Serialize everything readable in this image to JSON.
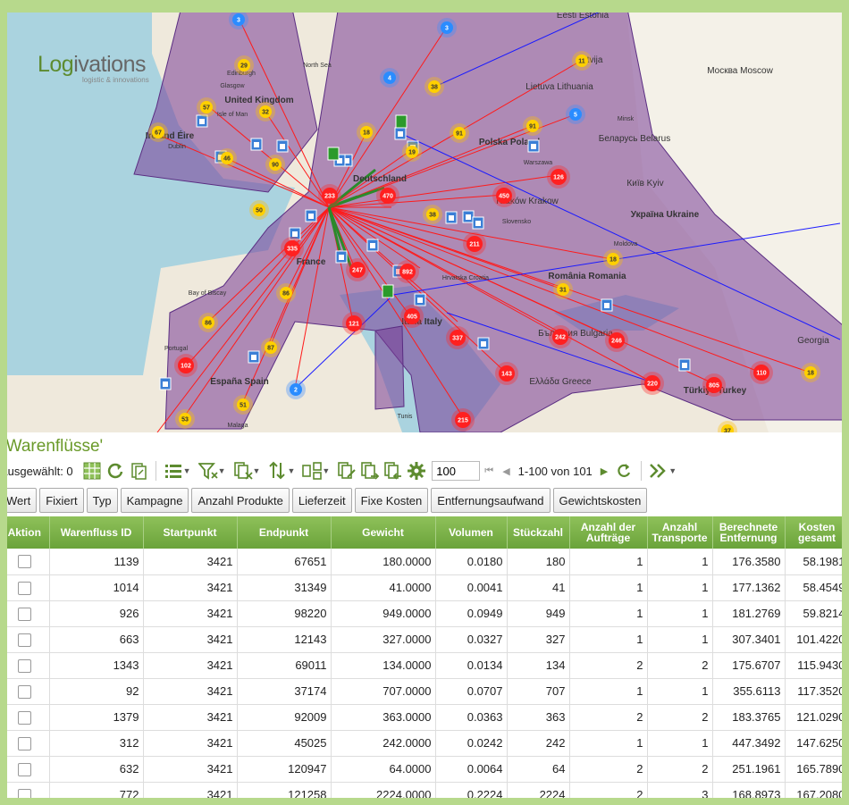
{
  "logo": {
    "main_a": "Log",
    "main_b": "ivations",
    "sub": "logistic & innovations"
  },
  "map_labels": [
    {
      "text": "United Kingdom"
    },
    {
      "text": "Ireland Éire"
    },
    {
      "text": "Deutschland"
    },
    {
      "text": "Polska Poland"
    },
    {
      "text": "France"
    },
    {
      "text": "España Spain"
    },
    {
      "text": "Italia Italy"
    },
    {
      "text": "România Romania"
    },
    {
      "text": "Україна Ukraine"
    },
    {
      "text": "Türkiye Turkey"
    },
    {
      "text": "Беларусь Belarus"
    },
    {
      "text": "Lietuva Lithuania"
    },
    {
      "text": "Eesti Estonia"
    },
    {
      "text": "Latvija"
    },
    {
      "text": "Москва Moscow"
    },
    {
      "text": "Kraków Krakow"
    },
    {
      "text": "Київ Kyiv"
    },
    {
      "text": "Ελλάδα Greece"
    },
    {
      "text": "България Bulgaria"
    },
    {
      "text": "Georgia"
    },
    {
      "text": "Edinburgh"
    },
    {
      "text": "Glasgow"
    },
    {
      "text": "Isle of Man"
    },
    {
      "text": "Dublin"
    },
    {
      "text": "Warszawa"
    },
    {
      "text": "Minsk"
    },
    {
      "text": "Moldova"
    },
    {
      "text": "Slovensko"
    },
    {
      "text": "Hrvatska Croatia"
    },
    {
      "text": "Portugal"
    },
    {
      "text": "Tunis"
    },
    {
      "text": "Malaga"
    },
    {
      "text": "North Sea"
    },
    {
      "text": "Bay of Biscay"
    }
  ],
  "clusters": [
    {
      "n": "3",
      "c": "blue"
    },
    {
      "n": "3",
      "c": "blue"
    },
    {
      "n": "29",
      "c": "yellow"
    },
    {
      "n": "57",
      "c": "yellow"
    },
    {
      "n": "32",
      "c": "yellow"
    },
    {
      "n": "67",
      "c": "yellow"
    },
    {
      "n": "46",
      "c": "yellow"
    },
    {
      "n": "90",
      "c": "yellow"
    },
    {
      "n": "18",
      "c": "yellow"
    },
    {
      "n": "19",
      "c": "yellow"
    },
    {
      "n": "91",
      "c": "yellow"
    },
    {
      "n": "91",
      "c": "yellow"
    },
    {
      "n": "11",
      "c": "yellow"
    },
    {
      "n": "5",
      "c": "blue"
    },
    {
      "n": "38",
      "c": "yellow"
    },
    {
      "n": "233",
      "c": "red"
    },
    {
      "n": "470",
      "c": "red"
    },
    {
      "n": "450",
      "c": "red"
    },
    {
      "n": "126",
      "c": "red"
    },
    {
      "n": "50",
      "c": "yellow"
    },
    {
      "n": "38",
      "c": "yellow"
    },
    {
      "n": "211",
      "c": "red"
    },
    {
      "n": "335",
      "c": "red"
    },
    {
      "n": "247",
      "c": "red"
    },
    {
      "n": "892",
      "c": "red"
    },
    {
      "n": "18",
      "c": "yellow"
    },
    {
      "n": "31",
      "c": "yellow"
    },
    {
      "n": "86",
      "c": "yellow"
    },
    {
      "n": "86",
      "c": "yellow"
    },
    {
      "n": "121",
      "c": "red"
    },
    {
      "n": "405",
      "c": "red"
    },
    {
      "n": "337",
      "c": "red"
    },
    {
      "n": "242",
      "c": "red"
    },
    {
      "n": "246",
      "c": "red"
    },
    {
      "n": "87",
      "c": "yellow"
    },
    {
      "n": "102",
      "c": "red"
    },
    {
      "n": "143",
      "c": "red"
    },
    {
      "n": "220",
      "c": "red"
    },
    {
      "n": "805",
      "c": "red"
    },
    {
      "n": "110",
      "c": "red"
    },
    {
      "n": "18",
      "c": "yellow"
    },
    {
      "n": "2",
      "c": "blue"
    },
    {
      "n": "51",
      "c": "yellow"
    },
    {
      "n": "53",
      "c": "yellow"
    },
    {
      "n": "215",
      "c": "red"
    },
    {
      "n": "37",
      "c": "yellow"
    },
    {
      "n": "4",
      "c": "blue"
    }
  ],
  "section_title": "'Warenflüsse'",
  "toolbar": {
    "selected_label": "Ausgewählt: 0",
    "page_size": "100",
    "pager_text": "1-100 von 101"
  },
  "column_buttons": [
    "Wert",
    "Fixiert",
    "Typ",
    "Kampagne",
    "Anzahl Produkte",
    "Lieferzeit",
    "Fixe Kosten",
    "Entfernungsaufwand",
    "Gewichtskosten"
  ],
  "table": {
    "headers": [
      "Aktion",
      "Warenfluss ID",
      "Startpunkt",
      "Endpunkt",
      "Gewicht",
      "Volumen",
      "Stückzahl",
      "Anzahl der Aufträge",
      "Anzahl Transporte",
      "Berechnete Entfernung",
      "Kosten gesamt"
    ],
    "rows": [
      [
        "1139",
        "3421",
        "67651",
        "180.0000",
        "0.0180",
        "180",
        "1",
        "1",
        "176.3580",
        "58.1981"
      ],
      [
        "1014",
        "3421",
        "31349",
        "41.0000",
        "0.0041",
        "41",
        "1",
        "1",
        "177.1362",
        "58.4549"
      ],
      [
        "926",
        "3421",
        "98220",
        "949.0000",
        "0.0949",
        "949",
        "1",
        "1",
        "181.2769",
        "59.8214"
      ],
      [
        "663",
        "3421",
        "12143",
        "327.0000",
        "0.0327",
        "327",
        "1",
        "1",
        "307.3401",
        "101.4220"
      ],
      [
        "1343",
        "3421",
        "69011",
        "134.0000",
        "0.0134",
        "134",
        "2",
        "2",
        "175.6707",
        "115.9430"
      ],
      [
        "92",
        "3421",
        "37174",
        "707.0000",
        "0.0707",
        "707",
        "1",
        "1",
        "355.6113",
        "117.3520"
      ],
      [
        "1379",
        "3421",
        "92009",
        "363.0000",
        "0.0363",
        "363",
        "2",
        "2",
        "183.3765",
        "121.0290"
      ],
      [
        "312",
        "3421",
        "45025",
        "242.0000",
        "0.0242",
        "242",
        "1",
        "1",
        "447.3492",
        "147.6250"
      ],
      [
        "632",
        "3421",
        "120947",
        "64.0000",
        "0.0064",
        "64",
        "2",
        "2",
        "251.1961",
        "165.7890"
      ],
      [
        "772",
        "3421",
        "121258",
        "2224.0000",
        "0.2224",
        "2224",
        "2",
        "3",
        "168.8973",
        "167.2080"
      ]
    ]
  }
}
